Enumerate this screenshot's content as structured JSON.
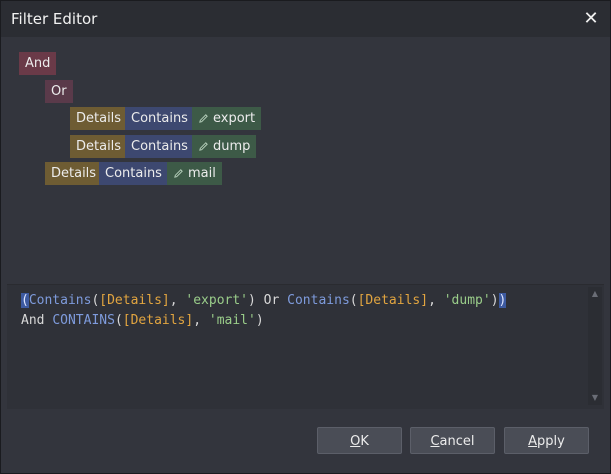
{
  "window": {
    "title": "Filter Editor",
    "close_icon": "close-icon"
  },
  "tree": {
    "root_group": "And",
    "or_group": "Or",
    "conditions": [
      {
        "field": "Details",
        "operator": "Contains",
        "value": "export"
      },
      {
        "field": "Details",
        "operator": "Contains",
        "value": "dump"
      },
      {
        "field": "Details",
        "operator": "Contains",
        "value": "mail"
      }
    ]
  },
  "expression": {
    "line1": {
      "paren_open": "(",
      "kw1": "Contains",
      "p1": "(",
      "field1": "[Details]",
      "sep1": ", ",
      "str1": "'export'",
      "close1": ") ",
      "or_kw": "Or",
      "space1": " ",
      "kw2": "Contains",
      "p2": "(",
      "field2": "[Details]",
      "sep2": ", ",
      "str2": "'dump'",
      "close2": ")",
      "paren_close": ")"
    },
    "line2": {
      "and_kw": "And",
      "space1": " ",
      "kw3": "CONTAINS",
      "p3": "(",
      "field3": "[Details]",
      "sep3": ", ",
      "str3": "'mail'",
      "close3": ")"
    }
  },
  "buttons": {
    "ok": {
      "accel": "O",
      "rest": "K"
    },
    "cancel": {
      "accel": "C",
      "rest": "ancel"
    },
    "apply": {
      "accel": "A",
      "rest": "pply"
    }
  },
  "colors": {
    "group": "#6a3a48",
    "field": "#6e5c33",
    "operator": "#3d4870",
    "value": "#3d5a47",
    "keyword": "#7e9bdc",
    "field_text": "#e2a540",
    "string_text": "#9acd8a"
  }
}
